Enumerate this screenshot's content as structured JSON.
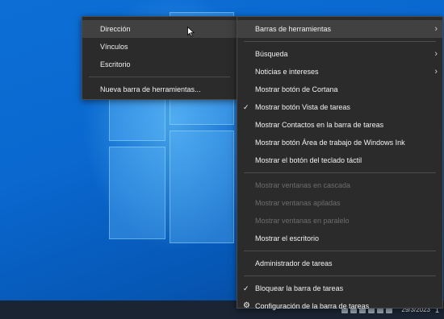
{
  "submenu": {
    "items": [
      {
        "label": "Dirección"
      },
      {
        "label": "Vínculos"
      },
      {
        "label": "Escritorio"
      },
      {
        "label": "Nueva barra de herramientas..."
      }
    ]
  },
  "menu": {
    "toolbars": "Barras de herramientas",
    "search": "Búsqueda",
    "news": "Noticias e intereses",
    "cortana": "Mostrar botón de Cortana",
    "taskview": "Mostrar botón Vista de tareas",
    "contacts": "Mostrar Contactos en la barra de tareas",
    "ink": "Mostrar botón Área de trabajo de Windows Ink",
    "keyboard": "Mostrar el botón del teclado táctil",
    "cascade": "Mostrar ventanas en cascada",
    "stacked": "Mostrar ventanas apiladas",
    "side": "Mostrar ventanas en paralelo",
    "desktop": "Mostrar el escritorio",
    "taskmgr": "Administrador de tareas",
    "lock": "Bloquear la barra de tareas",
    "settings": "Configuración de la barra de tareas"
  },
  "taskbar": {
    "date": "29/3/2023",
    "notification_count": "1"
  },
  "colors": {
    "menu_bg": "#2b2b2b",
    "hover_bg": "#414141",
    "disabled_text": "#6d6d6d",
    "desktop": "#0a68cf",
    "taskbar": "#1a2433"
  }
}
